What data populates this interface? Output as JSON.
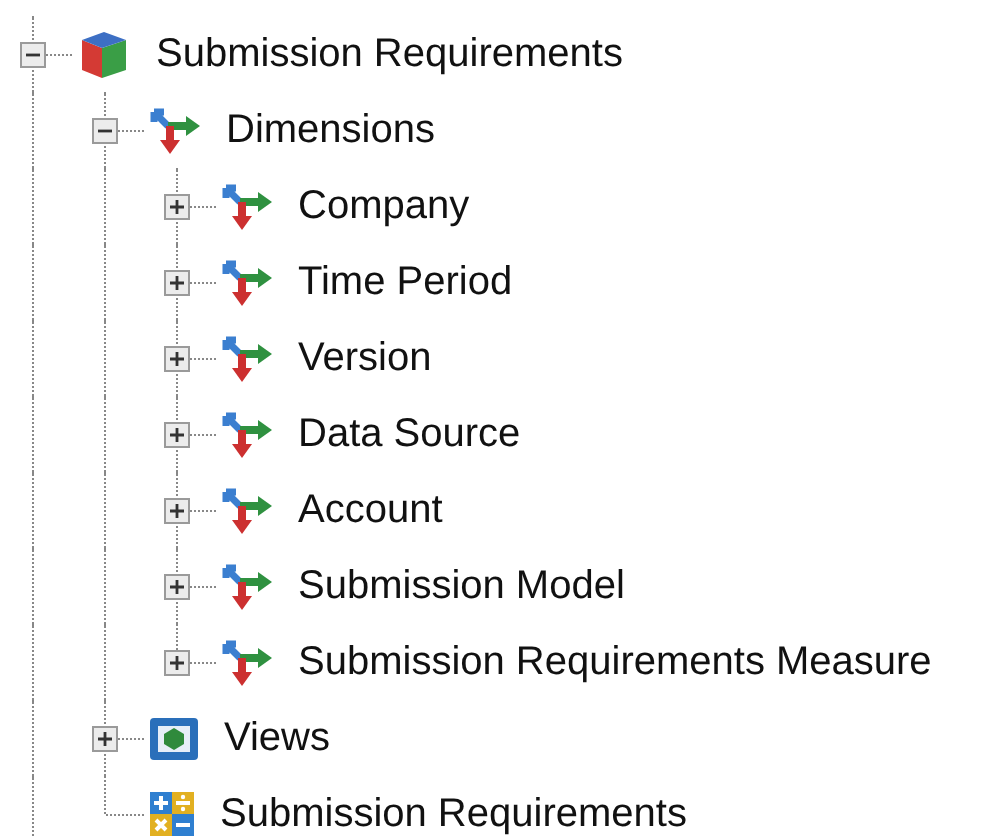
{
  "tree": [
    {
      "label": "Submission Requirements",
      "kind": "cube",
      "expanded": true,
      "children": [
        {
          "label": "Dimensions",
          "kind": "dimension",
          "expanded": true,
          "children": [
            {
              "label": "Company",
              "kind": "dimension",
              "expanded": false
            },
            {
              "label": "Time Period",
              "kind": "dimension",
              "expanded": false
            },
            {
              "label": "Version",
              "kind": "dimension",
              "expanded": false
            },
            {
              "label": "Data Source",
              "kind": "dimension",
              "expanded": false
            },
            {
              "label": "Account",
              "kind": "dimension",
              "expanded": false
            },
            {
              "label": "Submission Model",
              "kind": "dimension",
              "expanded": false
            },
            {
              "label": "Submission Requirements Measure",
              "kind": "dimension",
              "expanded": false
            }
          ]
        },
        {
          "label": "Views",
          "kind": "views",
          "expanded": false
        },
        {
          "label": "Submission Requirements",
          "kind": "calculation"
        }
      ]
    }
  ]
}
